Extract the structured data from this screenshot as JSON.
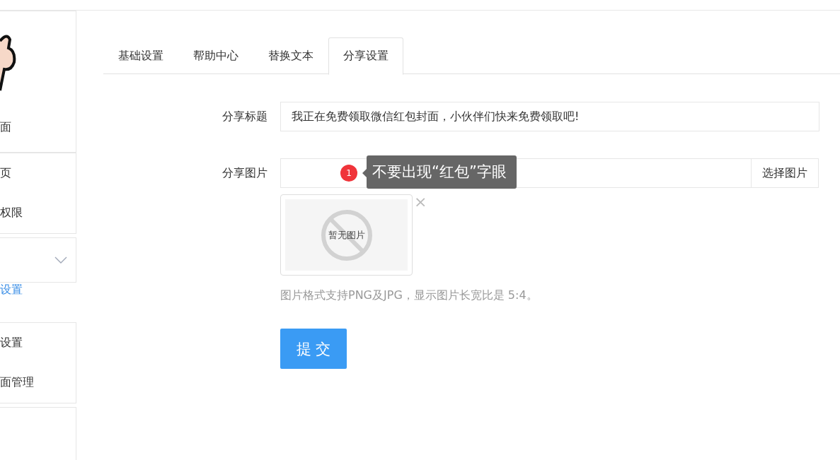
{
  "sidebar": {
    "groups": [
      {
        "kind": "avatar",
        "items": [
          {
            "label": "面",
            "selected": false
          }
        ]
      },
      {
        "kind": "list",
        "items": [
          {
            "label": "页",
            "selected": false
          },
          {
            "label": "权限",
            "selected": false
          }
        ]
      },
      {
        "kind": "collapse",
        "expanded": false
      },
      {
        "kind": "link",
        "items": [
          {
            "label": "设置",
            "selected": true
          }
        ]
      },
      {
        "kind": "list",
        "items": [
          {
            "label": "设置",
            "selected": false
          },
          {
            "label": "面管理",
            "selected": false
          }
        ]
      },
      {
        "kind": "empty"
      }
    ]
  },
  "tabs": [
    {
      "label": "基础设置",
      "selected": false
    },
    {
      "label": "帮助中心",
      "selected": false
    },
    {
      "label": "替换文本",
      "selected": false
    },
    {
      "label": "分享设置",
      "selected": true
    }
  ],
  "form": {
    "title_label": "分享标题",
    "title_value": "我正在免费领取微信红包封面，小伙伴们快来免费领取吧!",
    "image_label": "分享图片",
    "choose_button": "选择图片",
    "badge": "1",
    "tooltip": "不要出现“红包”字眼",
    "no_image_text": "暂无图片",
    "remove": "×",
    "hint": "图片格式支持PNG及JPG，显示图片长宽比是 5:4。",
    "submit": "提 交"
  }
}
